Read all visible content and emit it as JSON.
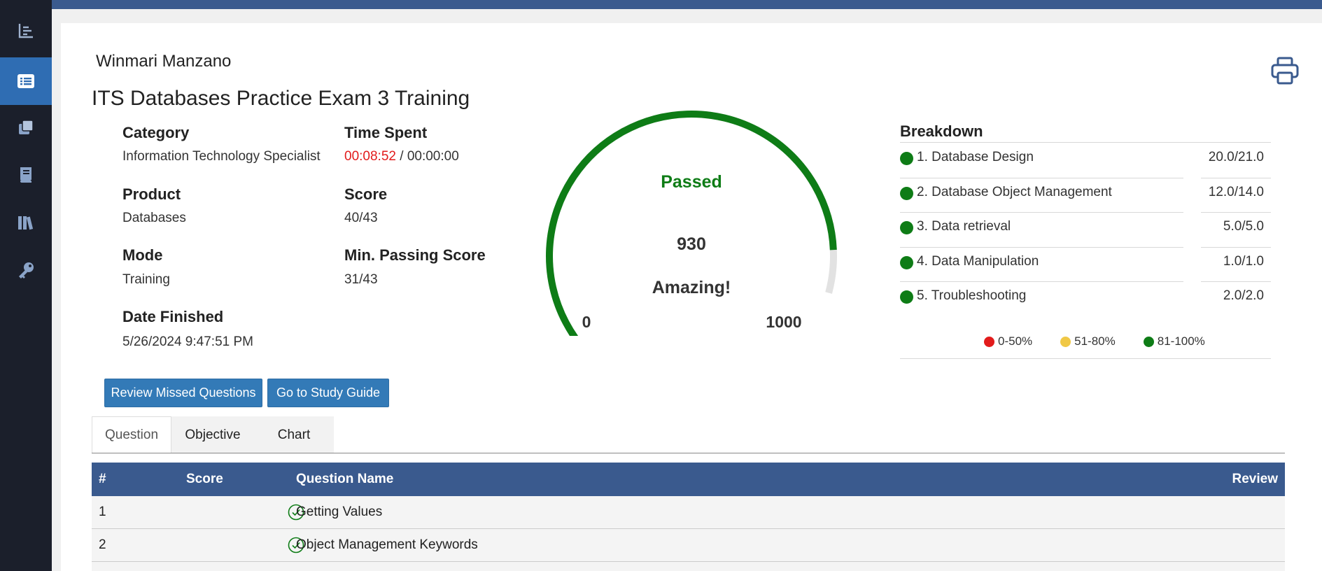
{
  "user": {
    "name": "Winmari Manzano"
  },
  "exam": {
    "title": "ITS Databases Practice Exam 3 Training"
  },
  "details": {
    "category_label": "Category",
    "category_value": "Information Technology Specialist",
    "time_label": "Time Spent",
    "time_spent": "00:08:52",
    "time_separator": " / ",
    "time_limit": "00:00:00",
    "product_label": "Product",
    "product_value": "Databases",
    "score_label": "Score",
    "score_value": "40/43",
    "mode_label": "Mode",
    "mode_value": "Training",
    "min_label": "Min. Passing Score",
    "min_value": "31/43",
    "date_label": "Date Finished",
    "date_value": "5/26/2024 9:47:51 PM"
  },
  "gauge": {
    "status": "Passed",
    "score": "930",
    "message": "Amazing!",
    "min": "0",
    "max": "1000",
    "score_fraction": 0.93,
    "color_fill": "#0e7c16",
    "color_track": "#e2e2e2"
  },
  "breakdown": {
    "title": "Breakdown",
    "items": [
      {
        "name": "1. Database Design",
        "score": "20.0/21.0"
      },
      {
        "name": "2. Database Object Management",
        "score": "12.0/14.0"
      },
      {
        "name": "3. Data retrieval",
        "score": "5.0/5.0"
      },
      {
        "name": "4. Data Manipulation",
        "score": "1.0/1.0"
      },
      {
        "name": "5. Troubleshooting",
        "score": "2.0/2.0"
      }
    ],
    "legend": [
      {
        "label": "0-50%",
        "color": "#e21b1b"
      },
      {
        "label": "51-80%",
        "color": "#f0c846"
      },
      {
        "label": "81-100%",
        "color": "#0e7c16"
      }
    ]
  },
  "actions": {
    "review_missed": "Review Missed Questions",
    "study_guide": "Go to Study Guide"
  },
  "tabs": [
    {
      "label": "Question"
    },
    {
      "label": "Objective"
    },
    {
      "label": "Chart"
    }
  ],
  "table": {
    "headers": {
      "num": "#",
      "score": "Score",
      "name": "Question Name",
      "review": "Review"
    },
    "rows": [
      {
        "num": "1",
        "name": "Getting Values"
      },
      {
        "num": "2",
        "name": "Object Management Keywords"
      }
    ]
  },
  "colors": {
    "header_blue": "#3a5a8e",
    "sidebar_bg": "#1b1f2b",
    "sidebar_active": "#2f6db3",
    "button_blue": "#337ab7",
    "pass_green": "#0e7c16"
  }
}
